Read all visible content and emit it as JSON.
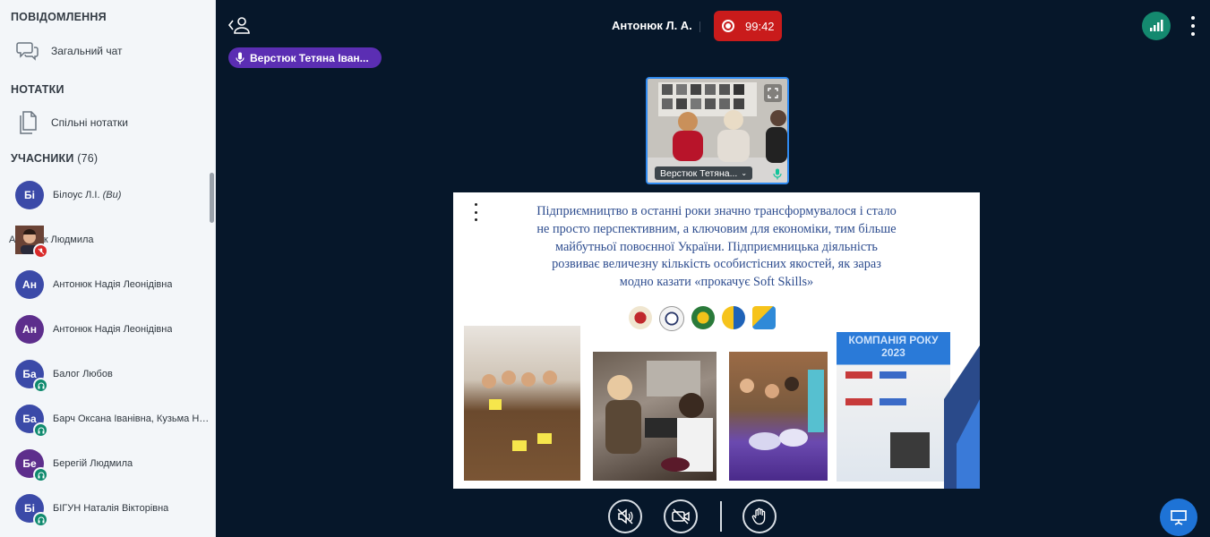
{
  "sidebar": {
    "messages_title": "ПОВІДОМЛЕННЯ",
    "public_chat": "Загальний чат",
    "notes_title": "НОТАТКИ",
    "shared_notes": "Спільні нотатки",
    "users_title": "УЧАСНИКИ",
    "users_count": "(76)",
    "users": [
      {
        "initials": "Бі",
        "name": "Білоус Л.І.",
        "suffix": "(Ви)",
        "color": "blue",
        "status": "none"
      },
      {
        "initials": "",
        "name": "Антонюк Людмила",
        "suffix": "",
        "color": "photo",
        "status": "muted"
      },
      {
        "initials": "Ан",
        "name": "Антонюк Надія Леонідівна",
        "suffix": "",
        "color": "blue",
        "status": "none"
      },
      {
        "initials": "Ан",
        "name": "Антонюк Надія Леонідівна",
        "suffix": "",
        "color": "purple",
        "status": "none"
      },
      {
        "initials": "Ба",
        "name": "Балог Любов",
        "suffix": "",
        "color": "blue",
        "status": "listen"
      },
      {
        "initials": "Ба",
        "name": "Барч Оксана Іванівна, Кузьма Нагорна",
        "suffix": "",
        "color": "blue",
        "status": "listen"
      },
      {
        "initials": "Бе",
        "name": "Берегій Людмила",
        "suffix": "",
        "color": "purple",
        "status": "listen"
      },
      {
        "initials": "Бі",
        "name": "БІГУН Наталія Вікторівна",
        "suffix": "",
        "color": "blue",
        "status": "listen"
      }
    ]
  },
  "topbar": {
    "presenter_name": "Антонюк Л. А.",
    "recording_time": "99:42",
    "current_talker": "Верстюк Тетяна Іван..."
  },
  "webcam": {
    "label": "Верстюк Тетяна..."
  },
  "slide": {
    "lines": [
      "Підприємництво в останні роки значно трансформувалося і стало",
      "не просто перспективним, а ключовим для економіки, тим більше",
      "майбутньої повоєнної України. Підприємницька діяльність",
      "розвиває величезну кількість особистісних якостей, як зараз",
      "модно казати «прокачує Soft Skills»"
    ],
    "photo4_text": "КОМПАНІЯ РОКУ 2023"
  },
  "colors": {
    "background": "#06172a",
    "sidebar": "#f3f6f9",
    "record": "#c91b1b",
    "talker": "#5b2eb3",
    "connection": "#14896f",
    "present": "#1e73d6"
  }
}
